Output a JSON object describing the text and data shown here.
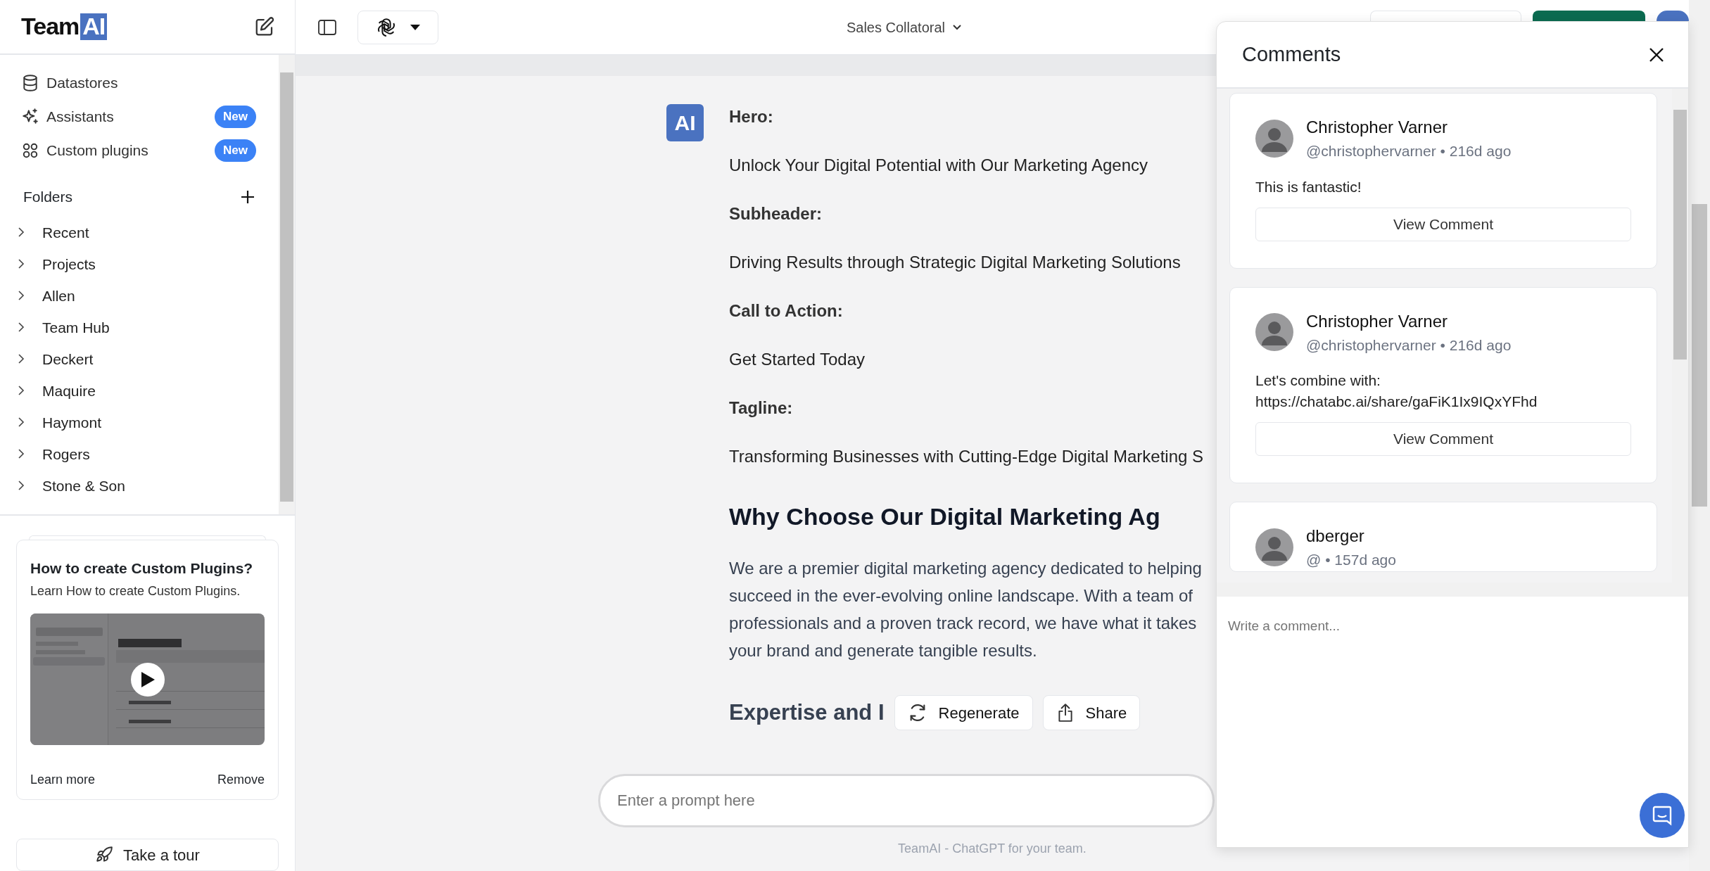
{
  "sidebar": {
    "logo": {
      "word": "Team",
      "mark": "AI"
    },
    "nav": [
      {
        "kind": "database",
        "label": "Datastores"
      },
      {
        "kind": "sparkles",
        "label": "Assistants",
        "badge": "New"
      },
      {
        "kind": "grid",
        "label": "Custom plugins",
        "badge": "New"
      }
    ],
    "folders_title": "Folders",
    "folders": [
      "Recent",
      "Projects",
      "Allen",
      "Team Hub",
      "Deckert",
      "Maquire",
      "Haymont",
      "Rogers",
      "Stone & Son"
    ],
    "promo": {
      "title": "How to create Custom Plugins?",
      "subtitle": "Learn How to create Custom Plugins.",
      "learn_more": "Learn more",
      "remove": "Remove"
    },
    "tour_button": "Take a tour"
  },
  "topbar": {
    "chat_title": "Sales Collatoral"
  },
  "message": {
    "avatar": "AI",
    "blocks": [
      {
        "kind": "label",
        "text": "Hero:"
      },
      {
        "kind": "text",
        "text": "Unlock Your Digital Potential with Our Marketing Agency"
      },
      {
        "kind": "label",
        "text": "Subheader:"
      },
      {
        "kind": "text",
        "text": "Driving Results through Strategic Digital Marketing Solutions"
      },
      {
        "kind": "label",
        "text": "Call to Action:"
      },
      {
        "kind": "text",
        "text": "Get Started Today"
      },
      {
        "kind": "label",
        "text": "Tagline:"
      },
      {
        "kind": "text",
        "text": "Transforming Businesses with Cutting-Edge Digital Marketing S"
      },
      {
        "kind": "heading",
        "text": "Why Choose Our Digital Marketing Ag"
      },
      {
        "kind": "paragraph",
        "lines": [
          "We are a premier digital marketing agency dedicated to helping",
          "succeed in the ever-evolving online landscape. With a team of",
          "professionals and a proven track record, we have what it takes",
          "your brand and generate tangible results."
        ]
      },
      {
        "kind": "subheading",
        "text": "Expertise and I"
      }
    ]
  },
  "actions": [
    {
      "kind": "refresh",
      "label": "Regenerate"
    },
    {
      "kind": "share",
      "label": "Share"
    }
  ],
  "prompt": {
    "placeholder": "Enter a prompt here"
  },
  "footer": "TeamAI - ChatGPT for your team.",
  "comments": {
    "title": "Comments",
    "items": [
      {
        "author": "Christopher Varner",
        "meta": "@christophervarner • 216d ago",
        "body": [
          "This is fantastic!"
        ],
        "button": "View Comment"
      },
      {
        "author": "Christopher Varner",
        "meta": "@christophervarner • 216d ago",
        "body": [
          "Let's combine with:",
          "https://chatabc.ai/share/gaFiK1Ix9IQxYFhd"
        ],
        "button": "View Comment"
      },
      {
        "author": "dberger",
        "meta": "@ • 157d ago"
      }
    ],
    "input": {
      "placeholder": "Write a comment..."
    }
  }
}
